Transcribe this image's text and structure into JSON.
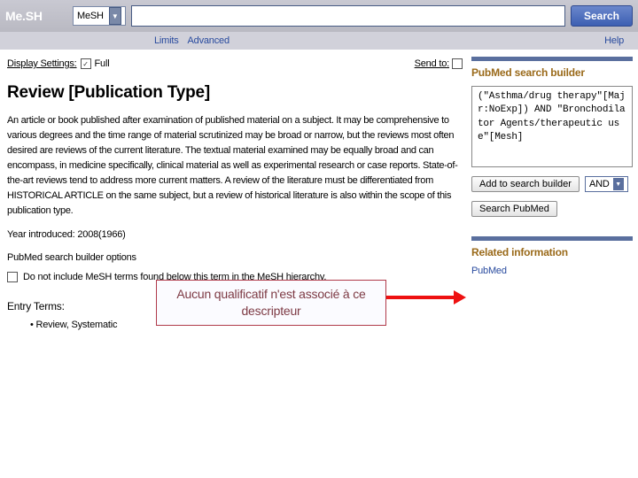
{
  "topbar": {
    "logo": "Me.SH",
    "db_selected": "MeSH",
    "search_btn": "Search"
  },
  "subbar": {
    "limits": "Limits",
    "advanced": "Advanced",
    "help": "Help"
  },
  "display": {
    "label": "Display Settings:",
    "mode": "Full",
    "sendto": "Send to:"
  },
  "page": {
    "title": "Review [Publication Type]",
    "description": "An article or book published after examination of published material on a subject. It may be comprehensive to various degrees and the time range of material scrutinized may be broad or narrow, but the reviews most often desired are reviews of the current literature. The textual material examined may be equally broad and can encompass, in medicine specifically, clinical material as well as experimental research or case reports. State-of-the-art reviews tend to address more current matters. A review of the literature must be differentiated from HISTORICAL ARTICLE on the same subject, but a review of historical literature is also within the scope of this publication type.",
    "year_introduced": "Year introduced: 2008(1966)",
    "options_title": "PubMed search builder options",
    "chk_label": "Do not include MeSH terms found below this term in the MeSH hierarchy.",
    "entry_terms_title": "Entry Terms:",
    "entry_term_1": "Review, Systematic"
  },
  "annotation": {
    "text": "Aucun qualificatif n'est associé à ce descripteur"
  },
  "side": {
    "builder_title": "PubMed search builder",
    "builder_content": "(\"Asthma/drug therapy\"[Majr:NoExp]) AND \"Bronchodilator Agents/therapeutic use\"[Mesh]",
    "add_btn": "Add to search builder",
    "bool_op": "AND",
    "search_pm_btn": "Search PubMed",
    "related_title": "Related information",
    "related_link": "PubMed"
  }
}
